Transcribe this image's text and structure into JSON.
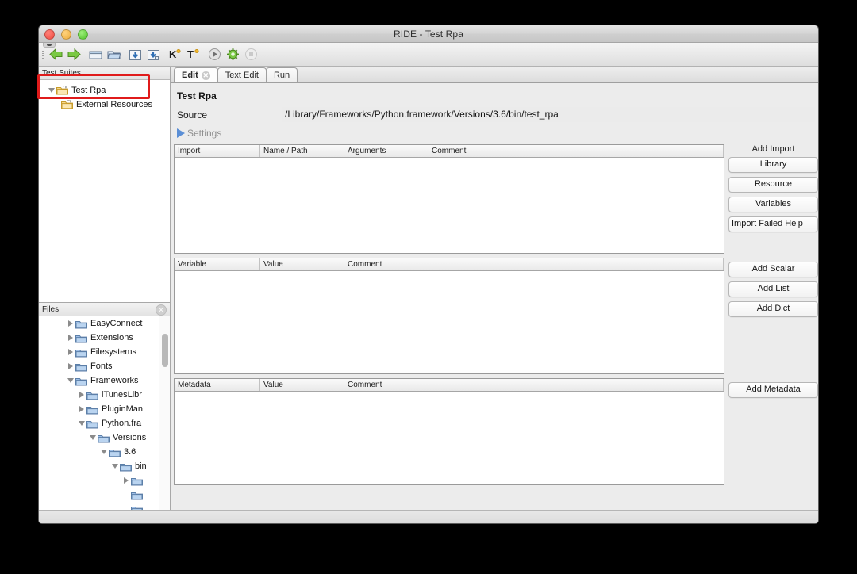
{
  "window": {
    "title": "RIDE - Test Rpa",
    "traffic_lights": [
      "close-red",
      "minimize-yellow",
      "maximize-green"
    ]
  },
  "toolbar": {
    "items": [
      {
        "name": "back-icon",
        "tooltip": "Back"
      },
      {
        "name": "forward-icon",
        "tooltip": "Forward"
      },
      {
        "name": "new-file-icon",
        "tooltip": "New Project"
      },
      {
        "name": "open-folder-icon",
        "tooltip": "Open Directory"
      },
      {
        "name": "save-icon",
        "tooltip": "Save"
      },
      {
        "name": "save-all-icon",
        "tooltip": "Save All"
      },
      {
        "name": "keyword-icon",
        "tooltip": "K"
      },
      {
        "name": "test-icon",
        "tooltip": "T"
      },
      {
        "name": "run-icon",
        "tooltip": "Run"
      },
      {
        "name": "debug-icon",
        "tooltip": "Debug"
      },
      {
        "name": "stop-icon",
        "tooltip": "Stop"
      }
    ]
  },
  "test_suites_panel": {
    "header": "Test Suites",
    "items": [
      {
        "label": "Test Rpa",
        "expanded": true,
        "indent": 0,
        "highlighted": true
      },
      {
        "label": "External Resources",
        "expanded": false,
        "indent": 1,
        "highlighted": false
      }
    ]
  },
  "files_panel": {
    "header": "Files",
    "close_glyph": "✕",
    "items": [
      {
        "label": "EasyConnect",
        "indent": 2,
        "state": "collapsed"
      },
      {
        "label": "Extensions",
        "indent": 2,
        "state": "collapsed"
      },
      {
        "label": "Filesystems",
        "indent": 2,
        "state": "collapsed"
      },
      {
        "label": "Fonts",
        "indent": 2,
        "state": "collapsed"
      },
      {
        "label": "Frameworks",
        "indent": 2,
        "state": "expanded"
      },
      {
        "label": "iTunesLibr",
        "indent": 3,
        "state": "collapsed"
      },
      {
        "label": "PluginMan",
        "indent": 3,
        "state": "collapsed"
      },
      {
        "label": "Python.fra",
        "indent": 3,
        "state": "expanded"
      },
      {
        "label": "Versions",
        "indent": 4,
        "state": "expanded"
      },
      {
        "label": "3.6",
        "indent": 5,
        "state": "expanded"
      },
      {
        "label": "bin",
        "indent": 6,
        "state": "expanded"
      },
      {
        "label": "",
        "indent": 7,
        "state": "collapsed"
      },
      {
        "label": "",
        "indent": 7,
        "state": "none"
      },
      {
        "label": "",
        "indent": 7,
        "state": "none"
      }
    ]
  },
  "editor": {
    "tabs": [
      {
        "label": "Edit",
        "active": true,
        "closable": true
      },
      {
        "label": "Text Edit",
        "active": false,
        "closable": false
      },
      {
        "label": "Run",
        "active": false,
        "closable": false
      }
    ],
    "tab_close_glyph": "✕",
    "form": {
      "title": "Test Rpa",
      "source_label": "Source",
      "source_value": "/Library/Frameworks/Python.framework/Versions/3.6/bin/test_rpa"
    },
    "settings": {
      "label": "Settings",
      "expander": "collapsed-triangle"
    },
    "import_table": {
      "columns": [
        "Import",
        "Name / Path",
        "Arguments",
        "Comment"
      ],
      "rows": []
    },
    "variable_table": {
      "columns": [
        "Variable",
        "Value",
        "Comment"
      ],
      "rows": []
    },
    "metadata_table": {
      "columns": [
        "Metadata",
        "Value",
        "Comment"
      ],
      "rows": []
    }
  },
  "side_buttons": {
    "import_title": "Add Import",
    "import_buttons": [
      "Library",
      "Resource",
      "Variables",
      "Import Failed Help"
    ],
    "variable_buttons": [
      "Add Scalar",
      "Add List",
      "Add Dict"
    ],
    "metadata_buttons": [
      "Add Metadata"
    ]
  },
  "annotation": {
    "highlight_color": "#e01b1b",
    "target": "Test Rpa"
  }
}
